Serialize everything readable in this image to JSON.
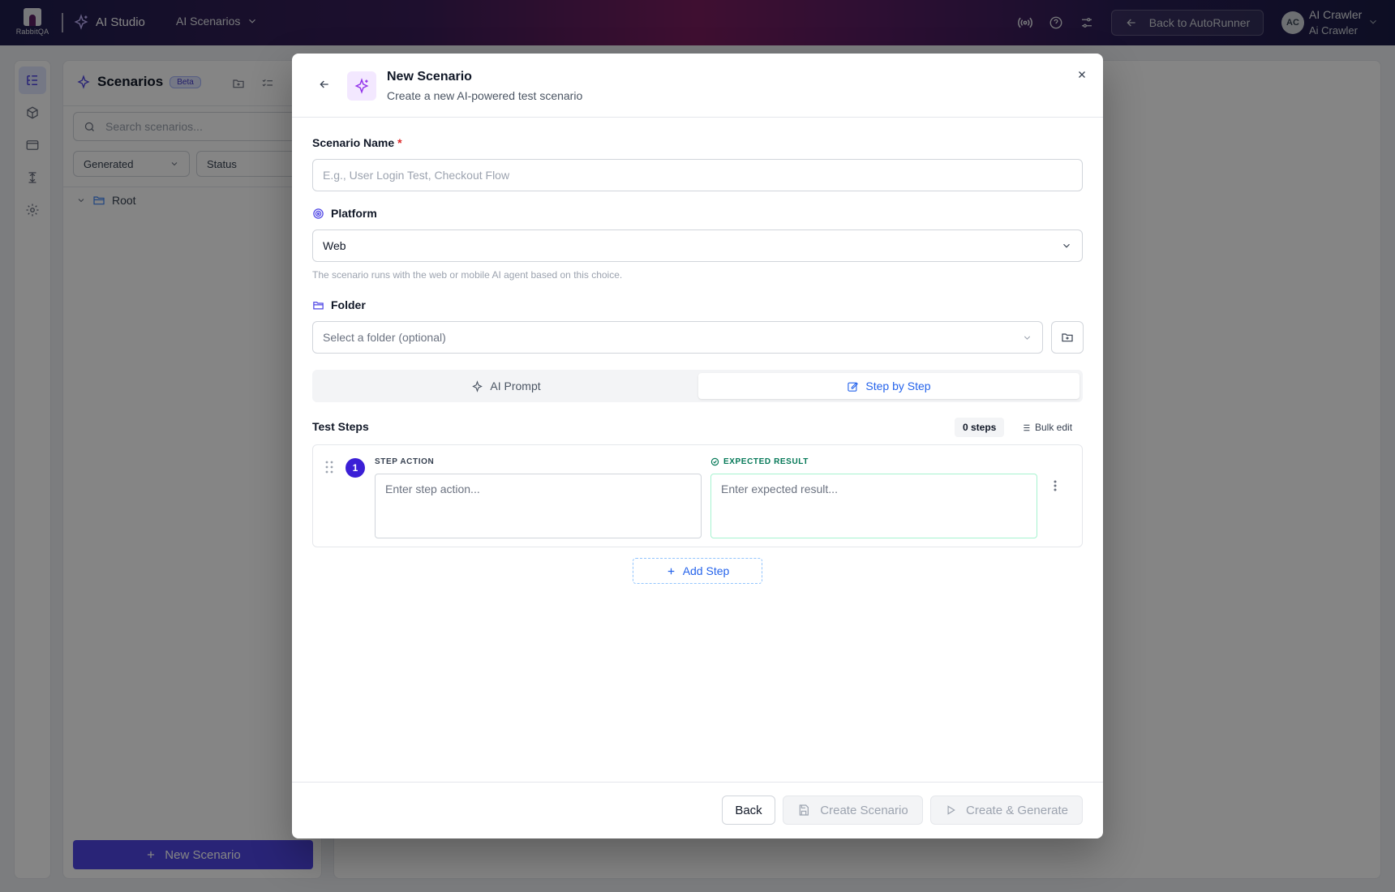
{
  "topbar": {
    "logo_text": "RabbitQA",
    "studio_label": "AI Studio",
    "nav_label": "AI Scenarios",
    "back_label": "Back to AutoRunner",
    "avatar_initials": "AC",
    "user_name": "AI Crawler",
    "user_sub": "Ai Crawler"
  },
  "panel": {
    "title": "Scenarios",
    "badge": "Beta",
    "search_placeholder": "Search scenarios...",
    "filter_generated": "Generated",
    "filter_status": "Status",
    "tree_root": "Root",
    "new_button": "New Scenario"
  },
  "modal": {
    "title": "New Scenario",
    "subtitle": "Create a new AI-powered test scenario",
    "name_label": "Scenario Name",
    "required_mark": "*",
    "name_placeholder": "E.g., User Login Test, Checkout Flow",
    "platform_label": "Platform",
    "platform_value": "Web",
    "platform_hint": "The scenario runs with the web or mobile AI agent based on this choice.",
    "folder_label": "Folder",
    "folder_placeholder": "Select a folder (optional)",
    "tabs": [
      {
        "label": "AI Prompt",
        "active": false
      },
      {
        "label": "Step by Step",
        "active": true
      }
    ],
    "steps_title": "Test Steps",
    "steps_count": "0 steps",
    "bulk_label": "Bulk edit",
    "step": {
      "number": "1",
      "action_label": "STEP ACTION",
      "action_placeholder": "Enter step action...",
      "expected_label": "EXPECTED RESULT",
      "expected_placeholder": "Enter expected result..."
    },
    "add_step": "Add Step",
    "footer": {
      "back": "Back",
      "create": "Create Scenario",
      "create_generate": "Create & Generate"
    }
  },
  "colors": {
    "accent": "#4f46e5",
    "link": "#2563eb",
    "step_badge": "#3b1fd6",
    "success": "#047857"
  }
}
